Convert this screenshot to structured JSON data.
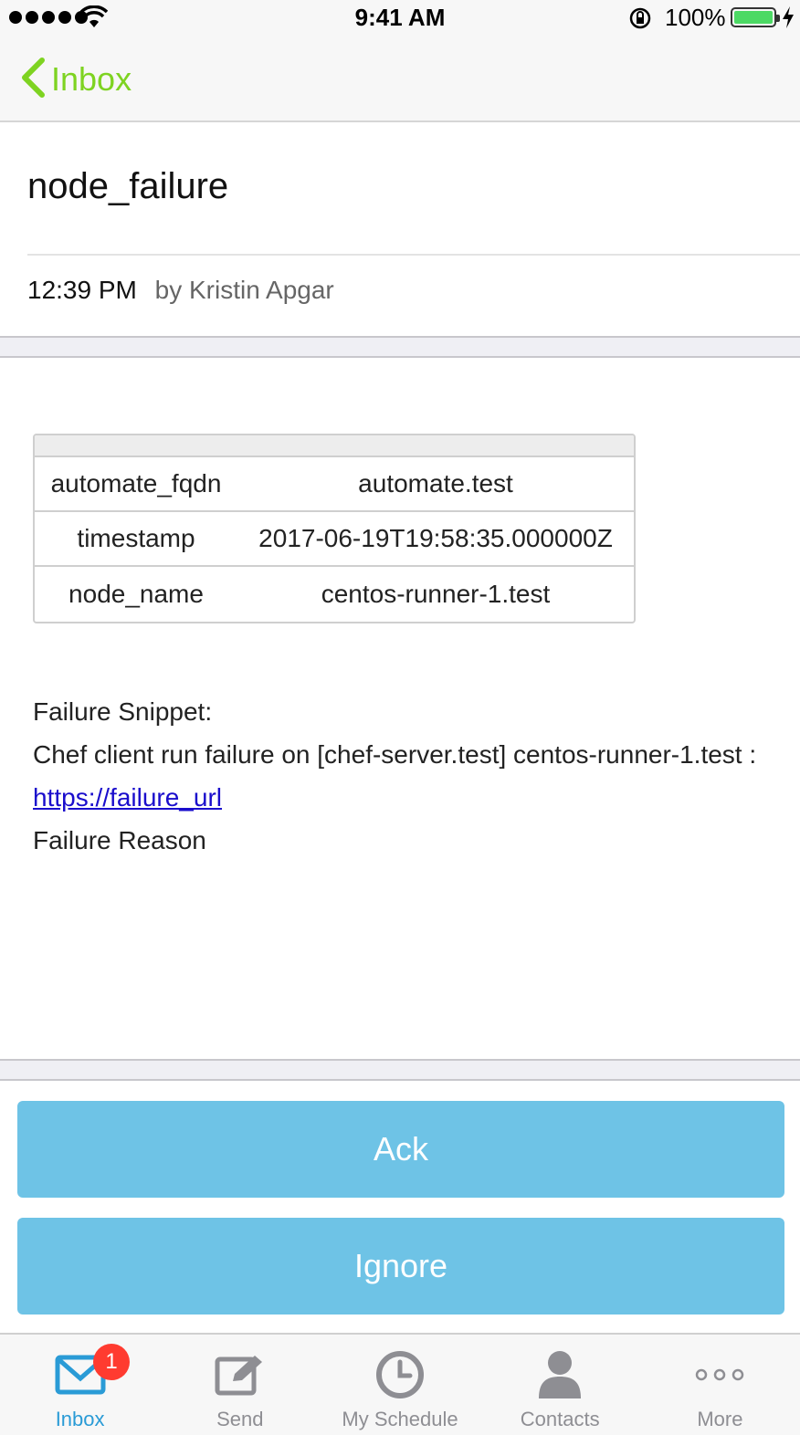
{
  "status_bar": {
    "time": "9:41 AM",
    "battery_percent": "100%",
    "battery_level": 1.0
  },
  "nav": {
    "back_label": "Inbox"
  },
  "message": {
    "subject": "node_failure",
    "time": "12:39 PM",
    "author": "by Kristin Apgar"
  },
  "table": {
    "rows": [
      {
        "key": "automate_fqdn",
        "value": "automate.test"
      },
      {
        "key": "timestamp",
        "value": "2017-06-19T19:58:35.000000Z"
      },
      {
        "key": "node_name",
        "value": "centos-runner-1.test"
      }
    ]
  },
  "body": {
    "snippet_label": "Failure Snippet:",
    "snippet_text": "Chef client run failure on [chef-server.test] centos-runner-1.test : ",
    "link_text": "https://failure_url",
    "reason_label": "Failure Reason"
  },
  "actions": {
    "ack_label": "Ack",
    "ignore_label": "Ignore",
    "button_color": "#6ec3e6"
  },
  "tabs": [
    {
      "label": "Inbox",
      "icon": "envelope-icon",
      "active": true,
      "badge": "1"
    },
    {
      "label": "Send",
      "icon": "compose-icon",
      "active": false
    },
    {
      "label": "My Schedule",
      "icon": "clock-icon",
      "active": false
    },
    {
      "label": "Contacts",
      "icon": "person-icon",
      "active": false
    },
    {
      "label": "More",
      "icon": "more-dots-icon",
      "active": false
    }
  ],
  "colors": {
    "accent_green": "#7ed321",
    "tab_active": "#2a9bd6",
    "badge_red": "#ff3b30"
  }
}
